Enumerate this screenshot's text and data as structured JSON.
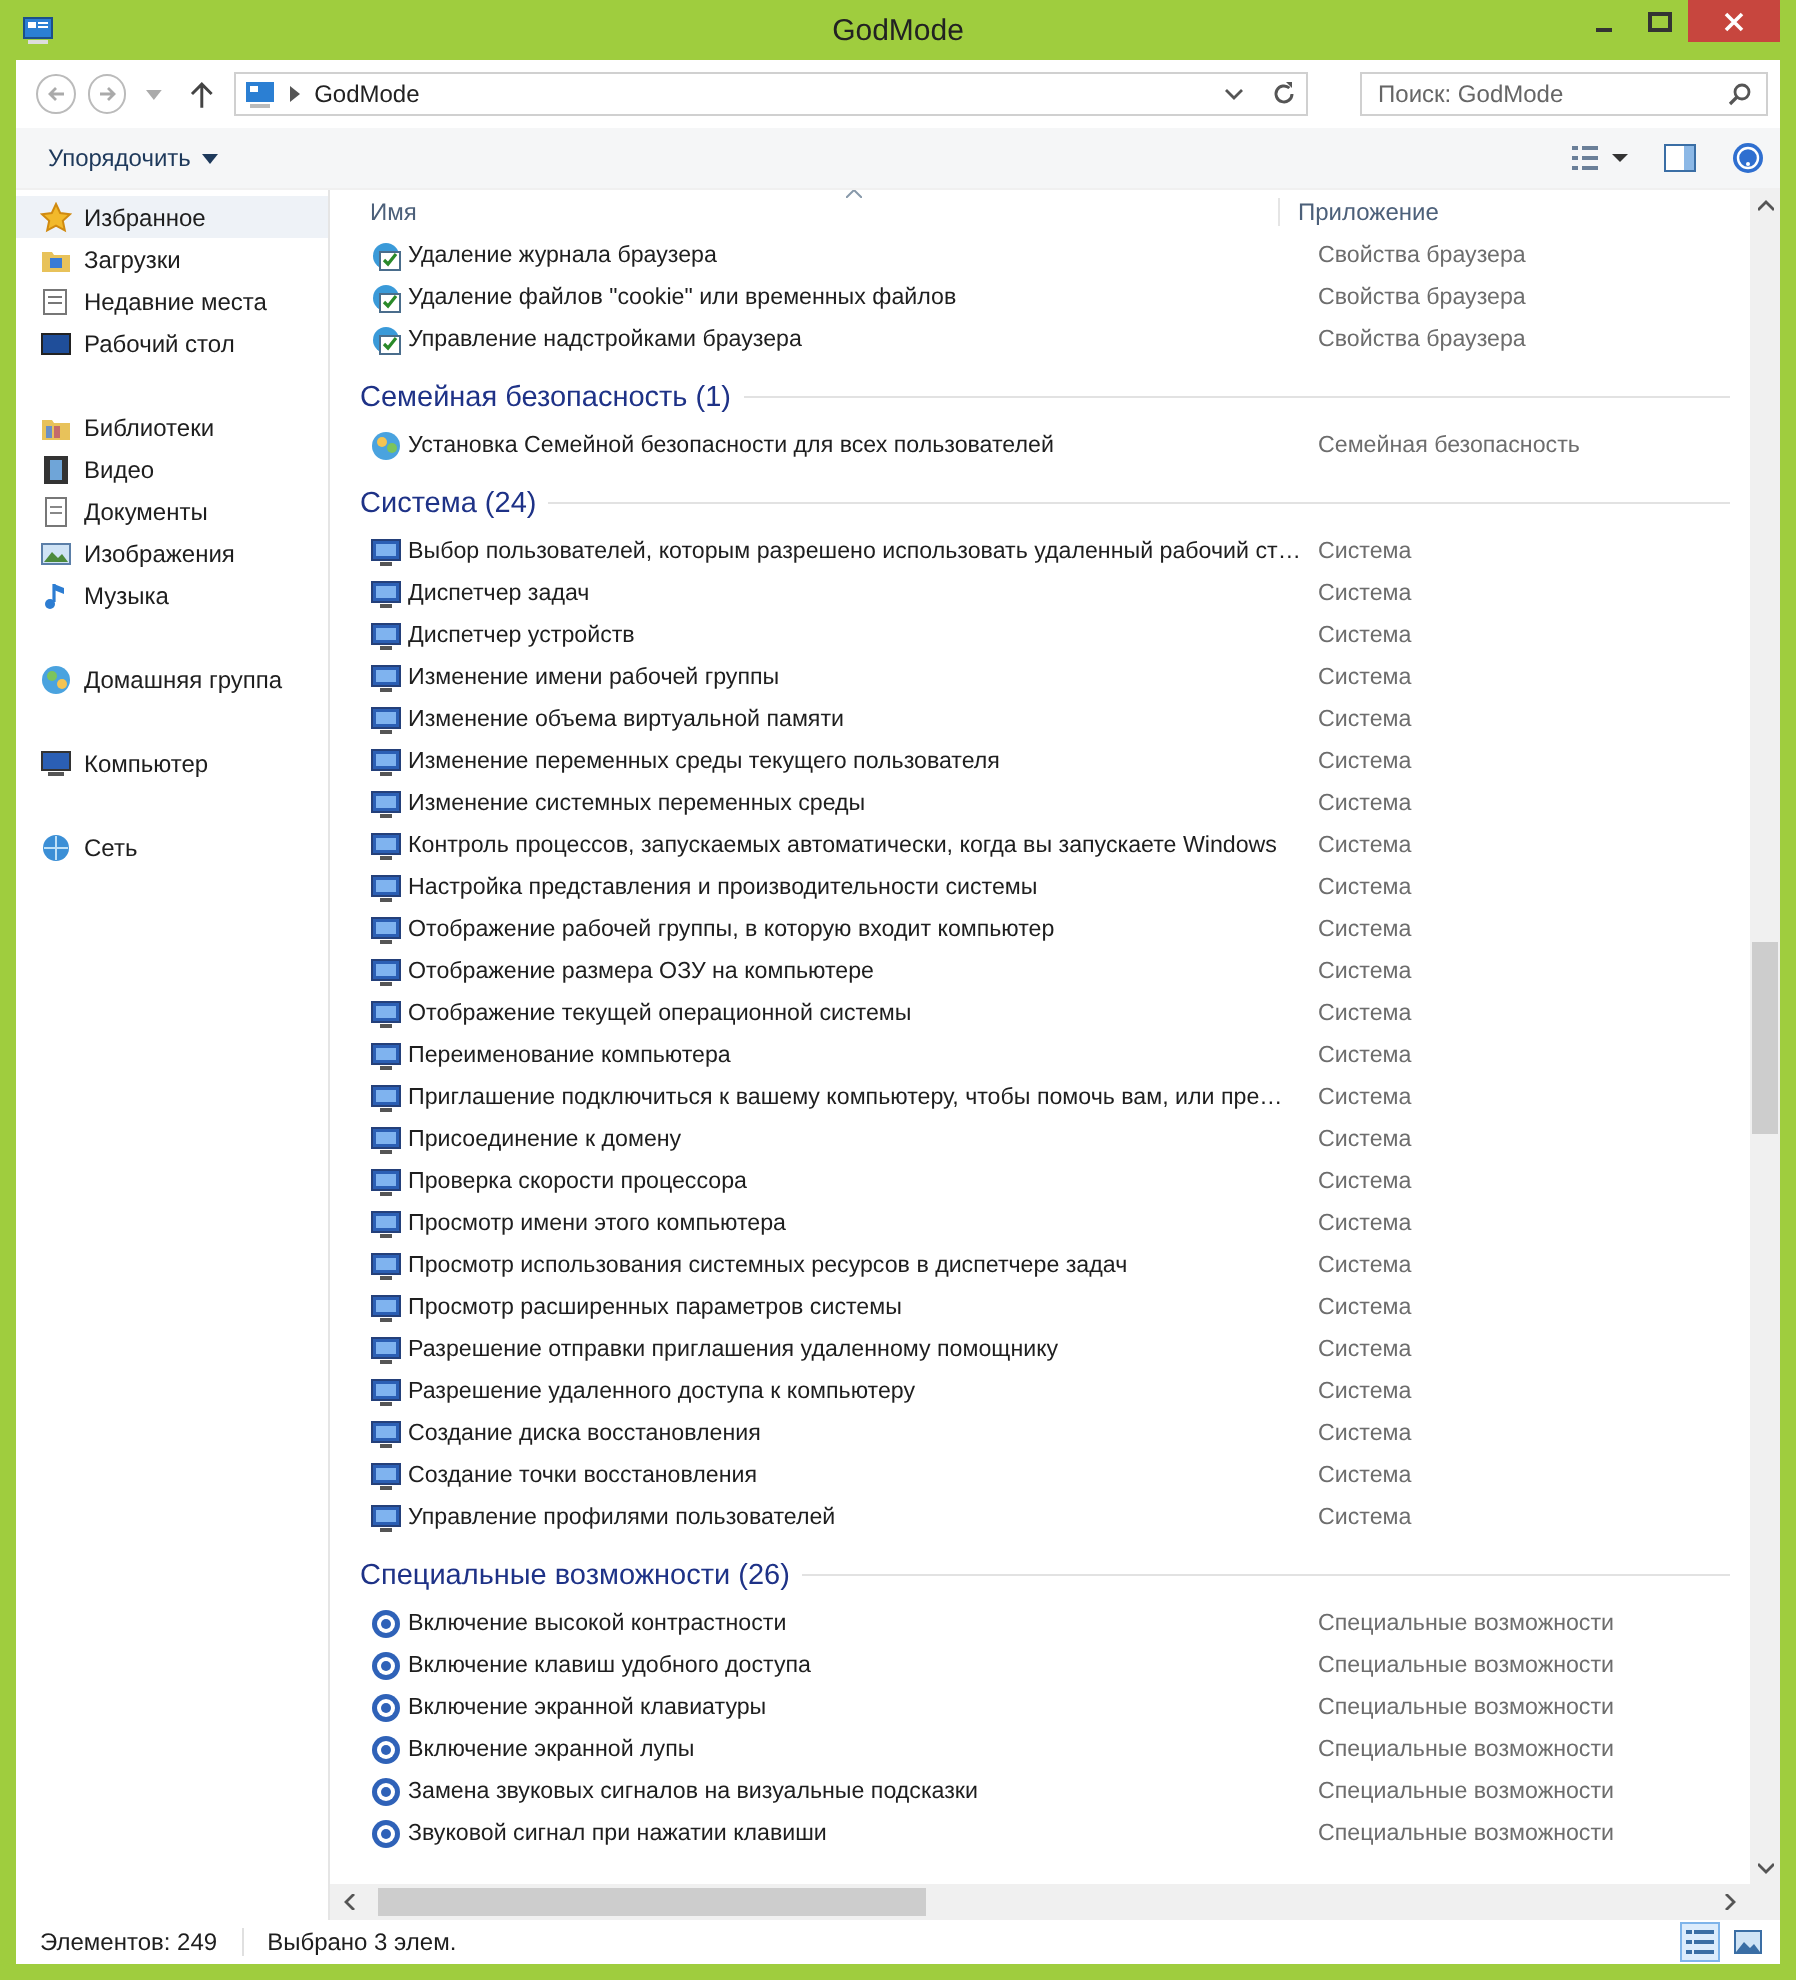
{
  "window": {
    "title": "GodMode"
  },
  "address": {
    "path": "GodMode",
    "search_placeholder": "Поиск: GodMode"
  },
  "toolbar": {
    "organize": "Упорядочить"
  },
  "sidebar": {
    "sections": [
      {
        "items": [
          {
            "label": "Избранное",
            "kind": "star",
            "selected": true
          },
          {
            "label": "Загрузки",
            "kind": "folder",
            "selected": false
          },
          {
            "label": "Недавние места",
            "kind": "places",
            "selected": false
          },
          {
            "label": "Рабочий стол",
            "kind": "desktop",
            "selected": false
          }
        ]
      },
      {
        "items": [
          {
            "label": "Библиотеки",
            "kind": "library",
            "selected": false
          },
          {
            "label": "Видео",
            "kind": "video",
            "selected": false
          },
          {
            "label": "Документы",
            "kind": "docs",
            "selected": false
          },
          {
            "label": "Изображения",
            "kind": "images",
            "selected": false
          },
          {
            "label": "Музыка",
            "kind": "music",
            "selected": false
          }
        ]
      },
      {
        "items": [
          {
            "label": "Домашняя группа",
            "kind": "homegroup",
            "selected": false
          }
        ]
      },
      {
        "items": [
          {
            "label": "Компьютер",
            "kind": "computer",
            "selected": false
          }
        ]
      },
      {
        "items": [
          {
            "label": "Сеть",
            "kind": "network",
            "selected": false
          }
        ]
      }
    ]
  },
  "columns": [
    "Имя",
    "Приложение"
  ],
  "groups": [
    {
      "rows": [
        {
          "name": "Удаление журнала браузера",
          "app": "Свойства браузера",
          "kind": "browser"
        },
        {
          "name": "Удаление файлов \"cookie\" или временных файлов",
          "app": "Свойства браузера",
          "kind": "browser"
        },
        {
          "name": "Управление надстройками браузера",
          "app": "Свойства браузера",
          "kind": "browser"
        }
      ]
    },
    {
      "title": "Семейная безопасность (1)",
      "rows": [
        {
          "name": "Установка Семейной безопасности для всех пользователей",
          "app": "Семейная безопасность",
          "kind": "family"
        }
      ]
    },
    {
      "title": "Система (24)",
      "rows": [
        {
          "name": "Выбор пользователей, которым разрешено использовать удаленный рабочий ст…",
          "app": "Система",
          "kind": "system"
        },
        {
          "name": "Диспетчер задач",
          "app": "Система",
          "kind": "system"
        },
        {
          "name": "Диспетчер устройств",
          "app": "Система",
          "kind": "system"
        },
        {
          "name": "Изменение имени рабочей группы",
          "app": "Система",
          "kind": "system"
        },
        {
          "name": "Изменение объема виртуальной памяти",
          "app": "Система",
          "kind": "system"
        },
        {
          "name": "Изменение переменных среды текущего пользователя",
          "app": "Система",
          "kind": "system"
        },
        {
          "name": "Изменение системных переменных среды",
          "app": "Система",
          "kind": "system"
        },
        {
          "name": "Контроль процессов, запускаемых автоматически, когда вы запускаете Windows",
          "app": "Система",
          "kind": "system"
        },
        {
          "name": "Настройка представления и производительности системы",
          "app": "Система",
          "kind": "system"
        },
        {
          "name": "Отображение рабочей группы, в которую входит компьютер",
          "app": "Система",
          "kind": "system"
        },
        {
          "name": "Отображение размера ОЗУ на компьютере",
          "app": "Система",
          "kind": "system"
        },
        {
          "name": "Отображение текущей операционной системы",
          "app": "Система",
          "kind": "system"
        },
        {
          "name": "Переименование компьютера",
          "app": "Система",
          "kind": "system"
        },
        {
          "name": "Приглашение подключиться к вашему компьютеру, чтобы помочь вам, или пре…",
          "app": "Система",
          "kind": "system"
        },
        {
          "name": "Присоединение к домену",
          "app": "Система",
          "kind": "system"
        },
        {
          "name": "Проверка скорости процессора",
          "app": "Система",
          "kind": "system"
        },
        {
          "name": "Просмотр имени этого компьютера",
          "app": "Система",
          "kind": "system"
        },
        {
          "name": "Просмотр использования системных ресурсов в диспетчере задач",
          "app": "Система",
          "kind": "system"
        },
        {
          "name": "Просмотр расширенных параметров системы",
          "app": "Система",
          "kind": "system"
        },
        {
          "name": "Разрешение отправки приглашения удаленному помощнику",
          "app": "Система",
          "kind": "system"
        },
        {
          "name": "Разрешение удаленного доступа к компьютеру",
          "app": "Система",
          "kind": "system"
        },
        {
          "name": "Создание диска восстановления",
          "app": "Система",
          "kind": "system"
        },
        {
          "name": "Создание точки восстановления",
          "app": "Система",
          "kind": "system"
        },
        {
          "name": "Управление профилями пользователей",
          "app": "Система",
          "kind": "system"
        }
      ]
    },
    {
      "title": "Специальные возможности (26)",
      "rows": [
        {
          "name": "Включение высокой контрастности",
          "app": "Специальные возможности",
          "kind": "access"
        },
        {
          "name": "Включение клавиш удобного доступа",
          "app": "Специальные возможности",
          "kind": "access"
        },
        {
          "name": "Включение экранной клавиатуры",
          "app": "Специальные возможности",
          "kind": "access"
        },
        {
          "name": "Включение экранной лупы",
          "app": "Специальные возможности",
          "kind": "access"
        },
        {
          "name": "Замена звуковых сигналов на визуальные подсказки",
          "app": "Специальные возможности",
          "kind": "access"
        },
        {
          "name": "Звуковой сигнал при нажатии клавиши",
          "app": "Специальные возможности",
          "kind": "access"
        }
      ]
    }
  ],
  "status_bar": {
    "count": "Элементов: 249",
    "selection": "Выбрано 3 элем.",
    "views": [
      {
        "kind": "details",
        "selected": true
      },
      {
        "kind": "tiles",
        "selected": false
      }
    ]
  }
}
